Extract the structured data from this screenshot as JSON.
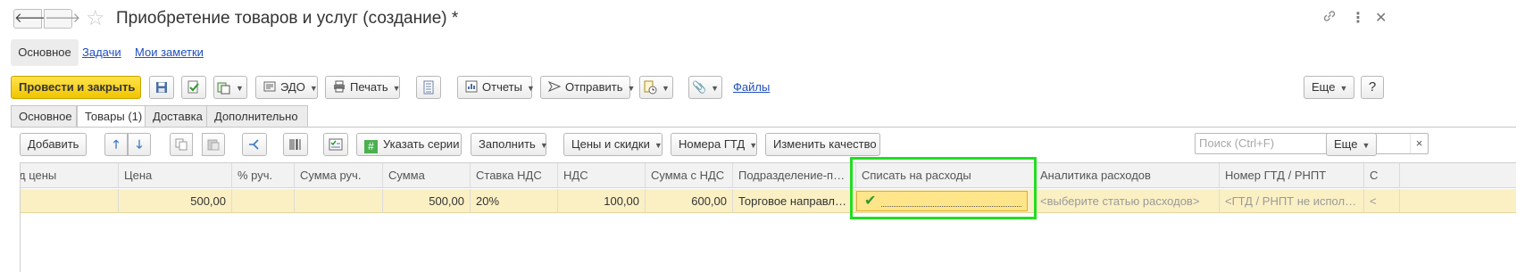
{
  "window": {
    "title": "Приобретение товаров и услуг (создание) *",
    "back_icon": "arrow-left",
    "forward_icon": "arrow-right",
    "favorite_icon": "star-outline",
    "link_icon": "chain-link",
    "more_icon": "vertical-dots",
    "close_icon": "close-x"
  },
  "sections": {
    "main": "Основное",
    "tasks": "Задачи",
    "notes": "Мои заметки"
  },
  "toolbar": {
    "post_close": "Провести и закрыть",
    "edo": "ЭДО",
    "print": "Печать",
    "reports": "Отчеты",
    "send": "Отправить",
    "files": "Файлы",
    "more": "Еще"
  },
  "tabs": {
    "main": "Основное",
    "goods": "Товары (1)",
    "delivery": "Доставка",
    "additional": "Дополнительно"
  },
  "table_toolbar": {
    "add": "Добавить",
    "set_series": "Указать серии",
    "fill": "Заполнить",
    "prices": "Цены и скидки",
    "gtd_numbers": "Номера ГТД",
    "change_quality": "Изменить качество",
    "search_placeholder": "Поиск (Ctrl+F)",
    "search_clear": "×",
    "more": "Еще"
  },
  "grid": {
    "columns": {
      "price_kind": "д цены",
      "price": "Цена",
      "manual_pct": "% руч.",
      "manual_sum": "Сумма руч.",
      "sum": "Сумма",
      "vat_rate": "Ставка НДС",
      "vat": "НДС",
      "sum_with_vat": "Сумма с НДС",
      "department": "Подразделение-пол...",
      "write_off": "Списать на расходы",
      "expense_analytics": "Аналитика расходов",
      "gtd": "Номер ГТД / РНПТ",
      "more": "С"
    },
    "rows": [
      {
        "price_kind": "",
        "price": "500,00",
        "manual_pct": "",
        "manual_sum": "",
        "sum": "500,00",
        "vat_rate": "20%",
        "vat": "100,00",
        "sum_with_vat": "600,00",
        "department": "Торговое направлен...",
        "write_off": true,
        "write_off_mark": "✔",
        "expense_analytics": "<выберите статью расходов>",
        "gtd": "<ГТД / РНПТ не использ...",
        "more": "<"
      }
    ]
  },
  "colors": {
    "primary_button": "#f5d000",
    "row_highlight": "#fbf0c4",
    "focus_frame": "#22dd22",
    "link": "#1f4fbf"
  }
}
